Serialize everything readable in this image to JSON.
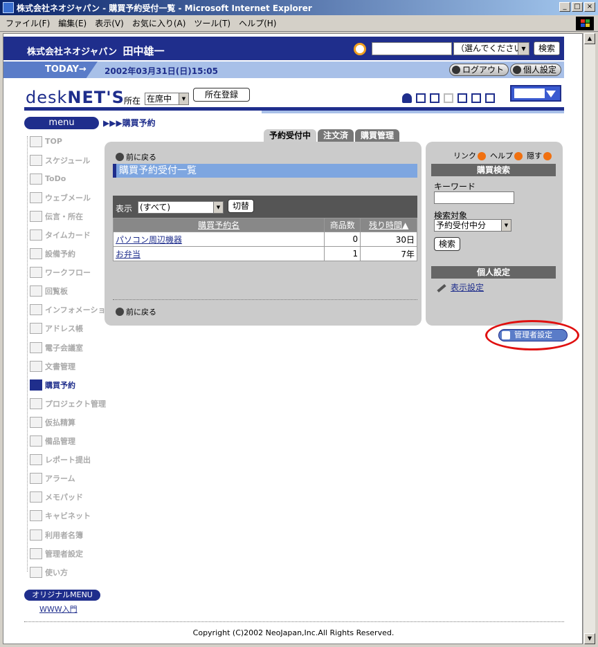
{
  "window": {
    "title": "株式会社ネオジャパン - 購買予約受付一覧 - Microsoft Internet Explorer",
    "buttons": [
      "_",
      "□",
      "×"
    ]
  },
  "menubar": [
    "ファイル(F)",
    "編集(E)",
    "表示(V)",
    "お気に入り(A)",
    "ツール(T)",
    "ヘルプ(H)"
  ],
  "header": {
    "company": "株式会社ネオジャパン",
    "user": "田中雄一",
    "search_scope": "（選んでください）",
    "search_button": "検索",
    "today_label": "TODAY→",
    "datetime": "2002年03月31日(日)15:05",
    "logout": "ログアウト",
    "personal": "個人設定"
  },
  "logo": {
    "a": "desk",
    "b": "NET'S"
  },
  "location": {
    "label": "所在",
    "value": "在席中",
    "register": "所在登録"
  },
  "menu": {
    "title": "menu",
    "breadcrumb": "▶▶▶購買予約",
    "items": [
      "TOP",
      "スケジュール",
      "ToDo",
      "ウェブメール",
      "伝言・所在",
      "タイムカード",
      "設備予約",
      "ワークフロー",
      "回覧板",
      "インフォメーション",
      "アドレス帳",
      "電子会議室",
      "文書管理",
      "購買予約",
      "プロジェクト管理",
      "仮払精算",
      "備品管理",
      "レポート提出",
      "アラーム",
      "メモパッド",
      "キャビネット",
      "利用者名簿",
      "管理者設定",
      "使い方"
    ],
    "active": "購買予約",
    "original": "オリジナルMENU",
    "www": "WWW入門"
  },
  "tabs": [
    "予約受付中",
    "注文済",
    "購買管理"
  ],
  "main": {
    "back": "前に戻る",
    "title": "購買予約受付一覧",
    "filter_label": "表示",
    "filter_value": "(すべて)",
    "filter_button": "切替",
    "columns": [
      "購買予約名",
      "商品数",
      "残り時間▲"
    ],
    "rows": [
      {
        "name": "パソコン周辺機器",
        "count": "0",
        "remain": "30日"
      },
      {
        "name": "お弁当",
        "count": "1",
        "remain": "7年"
      }
    ]
  },
  "side": {
    "links": [
      "リンク",
      "ヘルプ",
      "隠す"
    ],
    "search_head": "購買検索",
    "keyword": "キーワード",
    "target": "検索対象",
    "target_value": "予約受付中分",
    "search_button": "検索",
    "personal_head": "個人設定",
    "display_setting": "表示設定"
  },
  "admin_button": "管理者設定",
  "footer": "Copyright (C)2002 NeoJapan,Inc.All Rights Reserved.",
  "colors": {
    "navy": "#1f2e8c",
    "light_blue": "#a8c0e8",
    "panel_gray": "#cbcbcb",
    "highlight": "#e01010"
  }
}
